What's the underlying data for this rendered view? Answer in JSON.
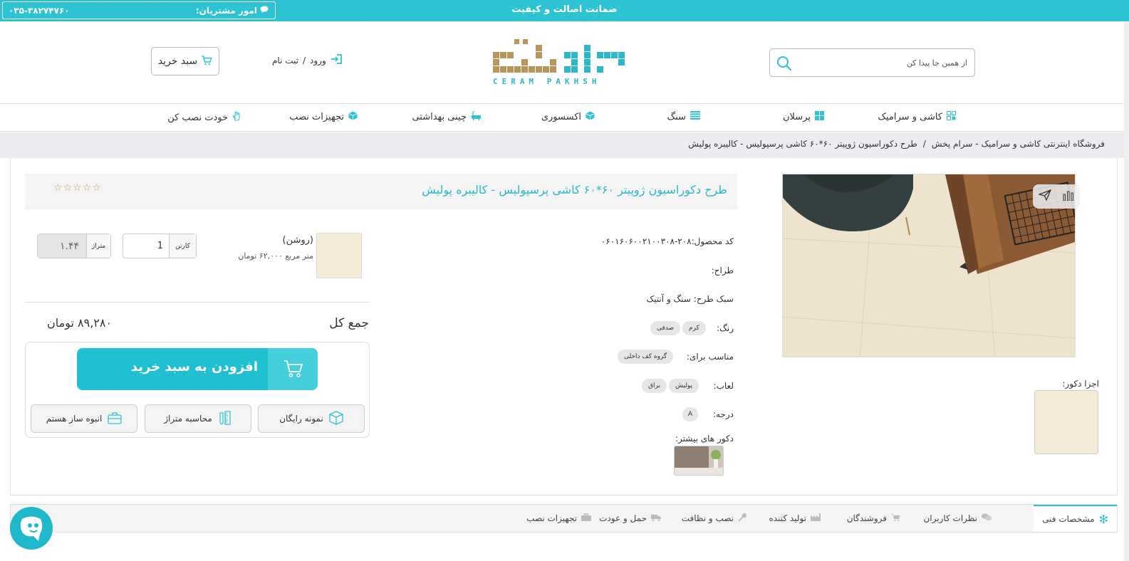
{
  "topbar": {
    "tagline": "ضمانت اصالت و کیفیت",
    "support_label": "امور مشتریان:",
    "support_phone": "۰۳۵-۳۸۲۷۴۷۶۰"
  },
  "header": {
    "search_placeholder": "از همین جا پیدا کن",
    "logo_brand": "CERAM PAKHSH",
    "login_label": "ورود",
    "register_label": "ثبت نام",
    "login_sep": "/",
    "cart_label": "سبد خرید"
  },
  "nav": {
    "items": [
      {
        "label": "کاشی و سرامیک",
        "icon": "tiles-icon"
      },
      {
        "label": "پرسلان",
        "icon": "grid-icon"
      },
      {
        "label": "سنگ",
        "icon": "layers-icon"
      },
      {
        "label": "اکسسوری",
        "icon": "cube-icon"
      },
      {
        "label": "چینی بهداشتی",
        "icon": "bathtub-icon"
      },
      {
        "label": "تجهیزات نصب",
        "icon": "cube-icon"
      },
      {
        "label": "خودت نصب کن",
        "icon": "hand-icon"
      }
    ]
  },
  "breadcrumb": {
    "home": "فروشگاه اینترنتی کاشی و سرامیک - سرام پخش",
    "sep": "/",
    "current": "طرح دکوراسیون ژوپیتر ۶۰*۶۰ کاشی پرسپولیس - کالیبره پولیش"
  },
  "product": {
    "title": "طرح دکوراسیون ژوپیتر ۶۰*۶۰ کاشی پرسپولیس - کالیبره پولیش",
    "stars": "☆☆☆☆☆",
    "code_label": "کد محصول:",
    "code_value": "۲۰۸-۰۶۰۱۶۰۶۰۰۲۱۰۰۳۰۸",
    "designer_label": "طراح:",
    "style_label": "سبک طرح:",
    "style_value": "سنگ و آنتیک",
    "color_label": "رنگ:",
    "colors": [
      "صدفی",
      "کرم"
    ],
    "suitable_label": "مناسب برای:",
    "suitable": [
      "گروه کف داخلی"
    ],
    "glaze_label": "لعاب:",
    "glazes": [
      "پولیش",
      "براق"
    ],
    "grade_label": "درجه:",
    "grade_value": "A",
    "more_decor_label": "دکور های بیشتر:",
    "decor_parts_label": "اجزا دکور:"
  },
  "purchase": {
    "variant_name": "(روشن)",
    "variant_price": "متر مربع ۶۲,۰۰۰ تومان",
    "qty_unit": "کارتن",
    "qty_value": "1",
    "area_unit": "متراژ",
    "area_value": "۱.۴۴",
    "total_label": "جمع کل",
    "total_value": "۸۹,۲۸۰ تومان",
    "add_to_cart": "افزودن به سبد خرید",
    "free_sample": "نمونه رایگان",
    "area_calc": "محاسبه متراژ",
    "wholesale": "انبوه ساز هستم"
  },
  "tabs": [
    {
      "label": "مشخصات فنی",
      "icon": "snowflake-icon"
    },
    {
      "label": "نظرات کاربران",
      "icon": "comments-icon"
    },
    {
      "label": "فروشندگان",
      "icon": "cart-icon"
    },
    {
      "label": "تولید کننده",
      "icon": "factory-icon"
    },
    {
      "label": "نصب و نظافت",
      "icon": "wrench-icon"
    },
    {
      "label": "حمل و عودت",
      "icon": "truck-icon"
    },
    {
      "label": "تجهیزات نصب",
      "icon": "toolbox-icon"
    }
  ],
  "colors": {
    "accent": "#2ec3d3",
    "logo_gold": "#b8955a"
  }
}
